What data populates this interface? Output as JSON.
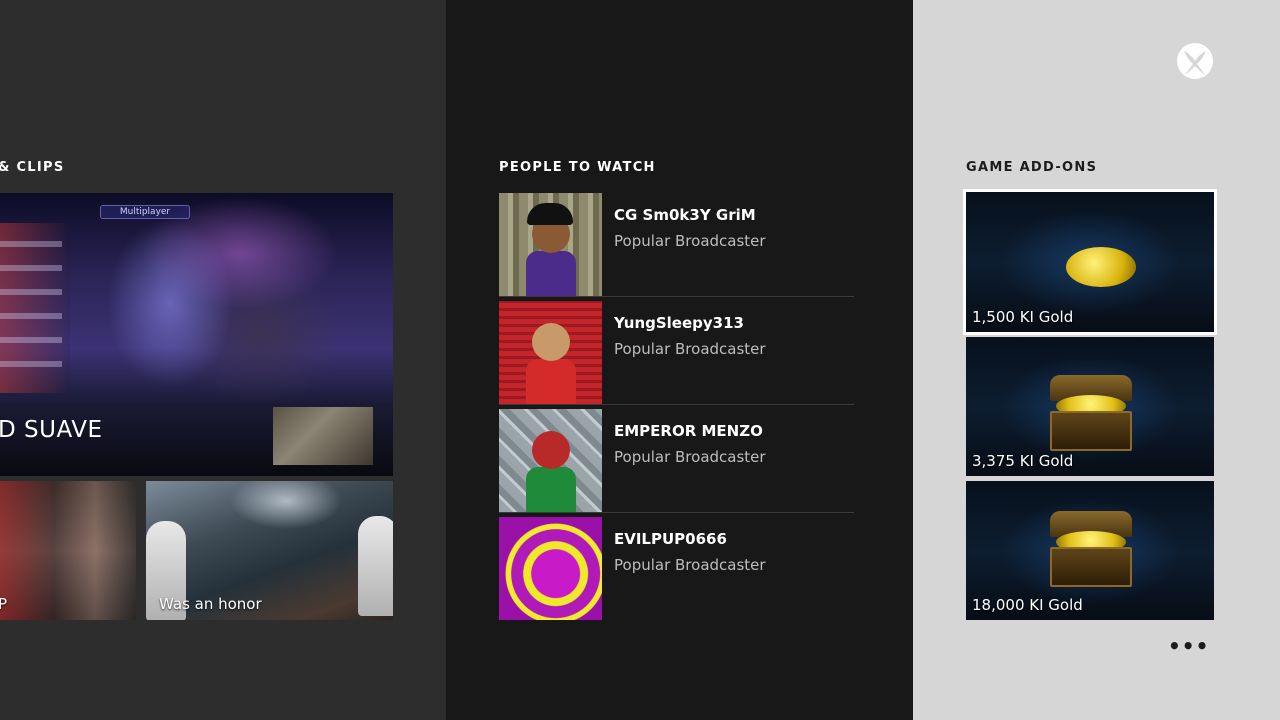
{
  "clips_section": {
    "heading": "& CLIPS",
    "main_clip": {
      "title": "D SUAVE",
      "hud_label": "Multiplayer"
    },
    "small_clips": [
      {
        "label": "P"
      },
      {
        "label": "Was an honor"
      }
    ]
  },
  "people_section": {
    "heading": "PEOPLE TO WATCH",
    "people": [
      {
        "name": "CG Sm0k3Y GriM",
        "role": "Popular Broadcaster"
      },
      {
        "name": "YungSleepy313",
        "role": "Popular Broadcaster"
      },
      {
        "name": "EMPEROR MENZO",
        "role": "Popular Broadcaster"
      },
      {
        "name": "EVILPUP0666",
        "role": "Popular Broadcaster"
      }
    ]
  },
  "addons_section": {
    "heading": "GAME ADD-ONS",
    "items": [
      {
        "label": "1,500 KI Gold"
      },
      {
        "label": "3,375 KI Gold"
      },
      {
        "label": "18,000 KI Gold"
      }
    ],
    "more_label": "•••"
  },
  "colors": {
    "clips_bg": "#2d2d2d",
    "people_bg": "#181818",
    "addons_bg": "#d6d6d6",
    "focus_border": "#ffffff"
  },
  "icons": {
    "brand": "xbox-logo-icon"
  }
}
